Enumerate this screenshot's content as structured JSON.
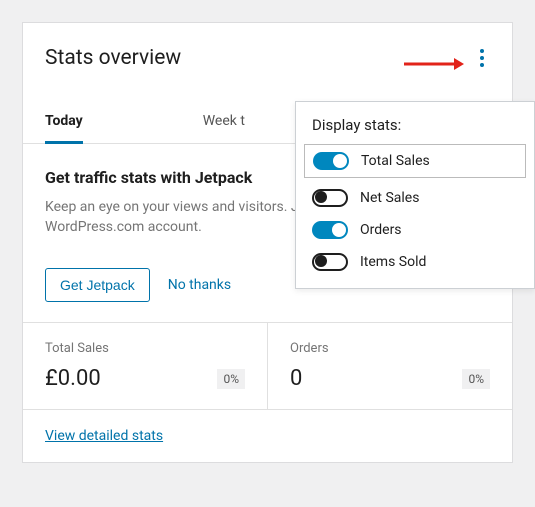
{
  "header": {
    "title": "Stats overview"
  },
  "tabs": {
    "today": "Today",
    "week": "Week t"
  },
  "promo": {
    "title": "Get traffic stats with Jetpack",
    "text": "Keep an eye on your views and visitors. Jetpack plugin and a WordPress.com account."
  },
  "actions": {
    "primary": "Get Jetpack",
    "secondary": "No thanks"
  },
  "stats": {
    "total_sales": {
      "label": "Total Sales",
      "value": "£0.00",
      "badge": "0%"
    },
    "orders": {
      "label": "Orders",
      "value": "0",
      "badge": "0%"
    }
  },
  "footer": {
    "link": "View detailed stats"
  },
  "popover": {
    "title": "Display stats:",
    "options": [
      {
        "label": "Total Sales",
        "on": true
      },
      {
        "label": "Net Sales",
        "on": false
      },
      {
        "label": "Orders",
        "on": true
      },
      {
        "label": "Items Sold",
        "on": false
      }
    ]
  }
}
